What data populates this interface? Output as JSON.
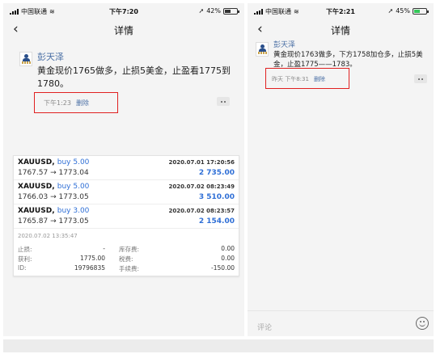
{
  "left": {
    "status": {
      "carrier": "中国联通",
      "time": "下午7:20",
      "battery": "42%"
    },
    "nav": {
      "back": "‹",
      "title": "详情"
    },
    "post": {
      "author": "彭天泽",
      "text": "黄金现价1765做多，止损5美金，止盈看1775到1780。",
      "time": "下午1:23",
      "delete_label": "删除"
    },
    "trades": [
      {
        "symbol": "XAUUSD,",
        "side": "buy 5.00",
        "date": "2020.07.01 17:20:56",
        "prices": "1767.57 → 1773.04",
        "profit": "2 735.00"
      },
      {
        "symbol": "XAUUSD,",
        "side": "buy 5.00",
        "date": "2020.07.02 08:23:49",
        "prices": "1766.03 → 1773.05",
        "profit": "3 510.00"
      },
      {
        "symbol": "XAUUSD,",
        "side": "buy 3.00",
        "date": "2020.07.02 08:23:57",
        "prices": "1765.87 → 1773.05",
        "profit": "2 154.00"
      }
    ],
    "close_date": "2020.07.02 13:35:47",
    "details": [
      {
        "l1": "止损:",
        "v1": "-",
        "l2": "库存费:",
        "v2": "0.00"
      },
      {
        "l1": "获利:",
        "v1": "1775.00",
        "l2": "税费:",
        "v2": "0.00"
      },
      {
        "l1": "ID:",
        "v1": "19796835",
        "l2": "手续费:",
        "v2": "-150.00"
      }
    ]
  },
  "right": {
    "status": {
      "carrier": "中国联通",
      "time": "下午2:21",
      "battery": "45%"
    },
    "nav": {
      "back": "‹",
      "title": "详情"
    },
    "post": {
      "author": "彭天泽",
      "text": "黄金现价1763做多，下方1758加仓多，止损5美金，止盈1775——1783。",
      "time": "昨天 下午8:31",
      "delete_label": "删除"
    },
    "comment_placeholder": "评论"
  },
  "colors": {
    "link": "#4a6fa5",
    "profit": "#2f6fd6",
    "highlight": "#e02020",
    "battery_right": "#34c759"
  }
}
